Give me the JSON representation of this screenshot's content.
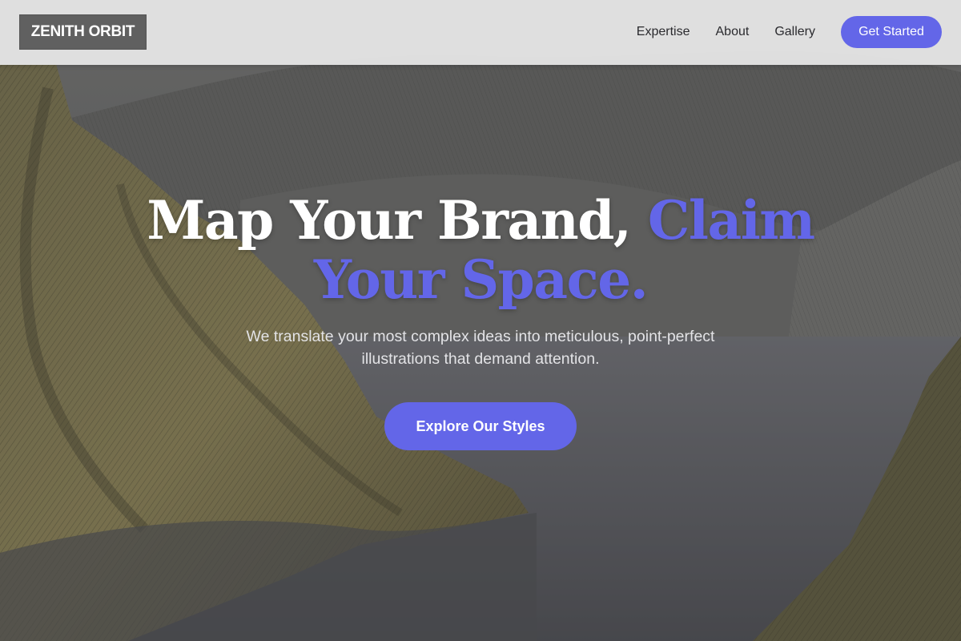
{
  "header": {
    "logo_text": "ZENITH ORBIT",
    "nav_items": [
      "Expertise",
      "About",
      "Gallery"
    ],
    "cta_label": "Get Started"
  },
  "hero": {
    "title_part1": "Map Your Brand, ",
    "title_accent": "Claim Your Space.",
    "subtitle": "We translate your most complex ideas into meticulous, point-perfect illustrations that demand attention.",
    "button_label": "Explore Our Styles"
  },
  "colors": {
    "accent": "#6366e8",
    "header_bg": "#e8e8e8",
    "logo_bg": "#606060",
    "title_text": "#ffffff",
    "subtitle_text": "#e3e3e6"
  },
  "icons": {
    "background": "landscape-illustration"
  }
}
